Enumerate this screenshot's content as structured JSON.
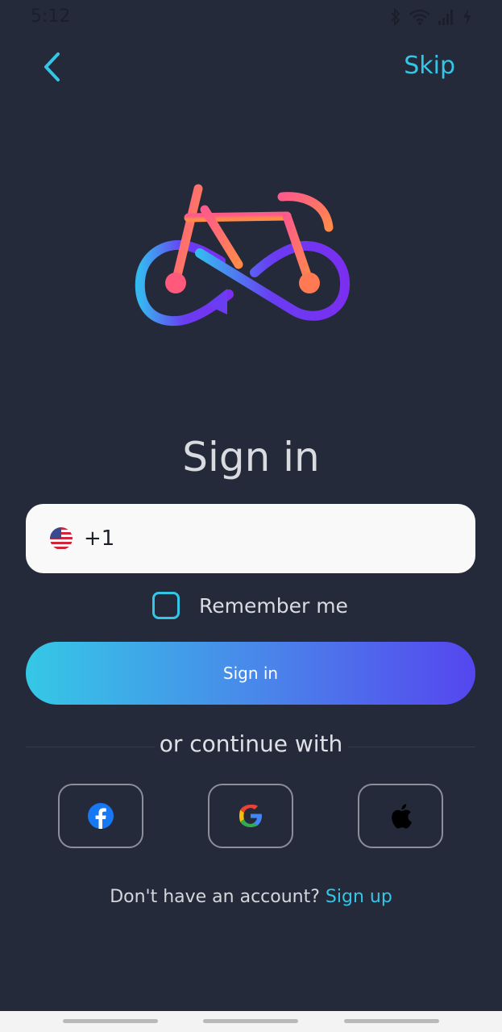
{
  "status_bar": {
    "time": "5:12"
  },
  "header": {
    "skip_label": "Skip"
  },
  "title": "Sign in",
  "phone": {
    "dial_code": "+1",
    "value": ""
  },
  "remember_me": {
    "label": "Remember me",
    "checked": false
  },
  "signin_button": {
    "label": "Sign in"
  },
  "divider": {
    "text": "or continue with"
  },
  "social": {
    "facebook": "facebook-icon",
    "google": "google-icon",
    "apple": "apple-icon"
  },
  "footer": {
    "prompt": "Don't have an account?",
    "link": "Sign up"
  },
  "colors": {
    "background": "#242a3a",
    "accent": "#33c6e6",
    "button_gradient_start": "#35c8e6",
    "button_gradient_end": "#5546ef"
  }
}
